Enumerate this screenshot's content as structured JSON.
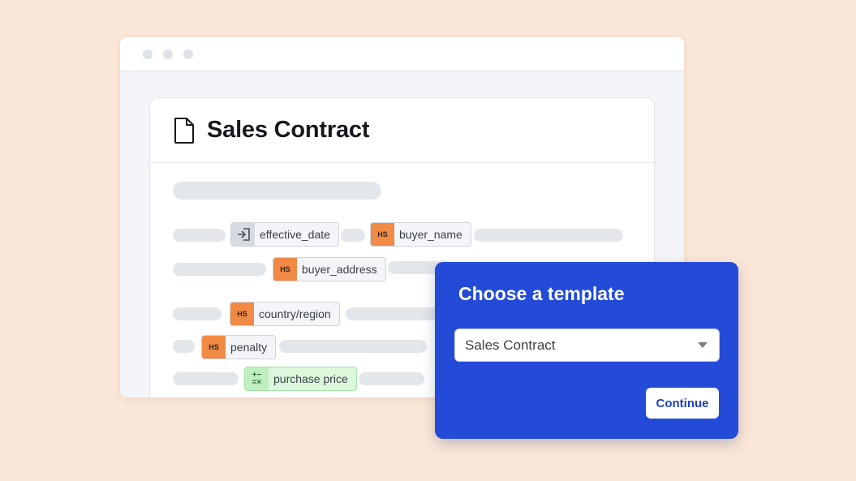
{
  "browser": {
    "window_dots": [
      "dot",
      "dot",
      "dot"
    ]
  },
  "document": {
    "title": "Sales Contract",
    "icon": "document-icon",
    "fields": [
      {
        "label": "effective_date",
        "badge": "",
        "icon": "import-icon"
      },
      {
        "label": "buyer_name",
        "badge": "HS"
      },
      {
        "label": "buyer_address",
        "badge": "HS"
      },
      {
        "label": "country/region",
        "badge": "HS"
      },
      {
        "label": "penalty",
        "badge": "HS"
      },
      {
        "label": "purchase price",
        "badge": "",
        "icon": "calculator-icon"
      }
    ]
  },
  "modal": {
    "title": "Choose a template",
    "select_value": "Sales Contract",
    "continue_label": "Continue"
  },
  "colors": {
    "background": "#fbe7d8",
    "accent": "#244bd8",
    "badge_orange": "#f08a45",
    "formula_green": "#bfeec0"
  }
}
